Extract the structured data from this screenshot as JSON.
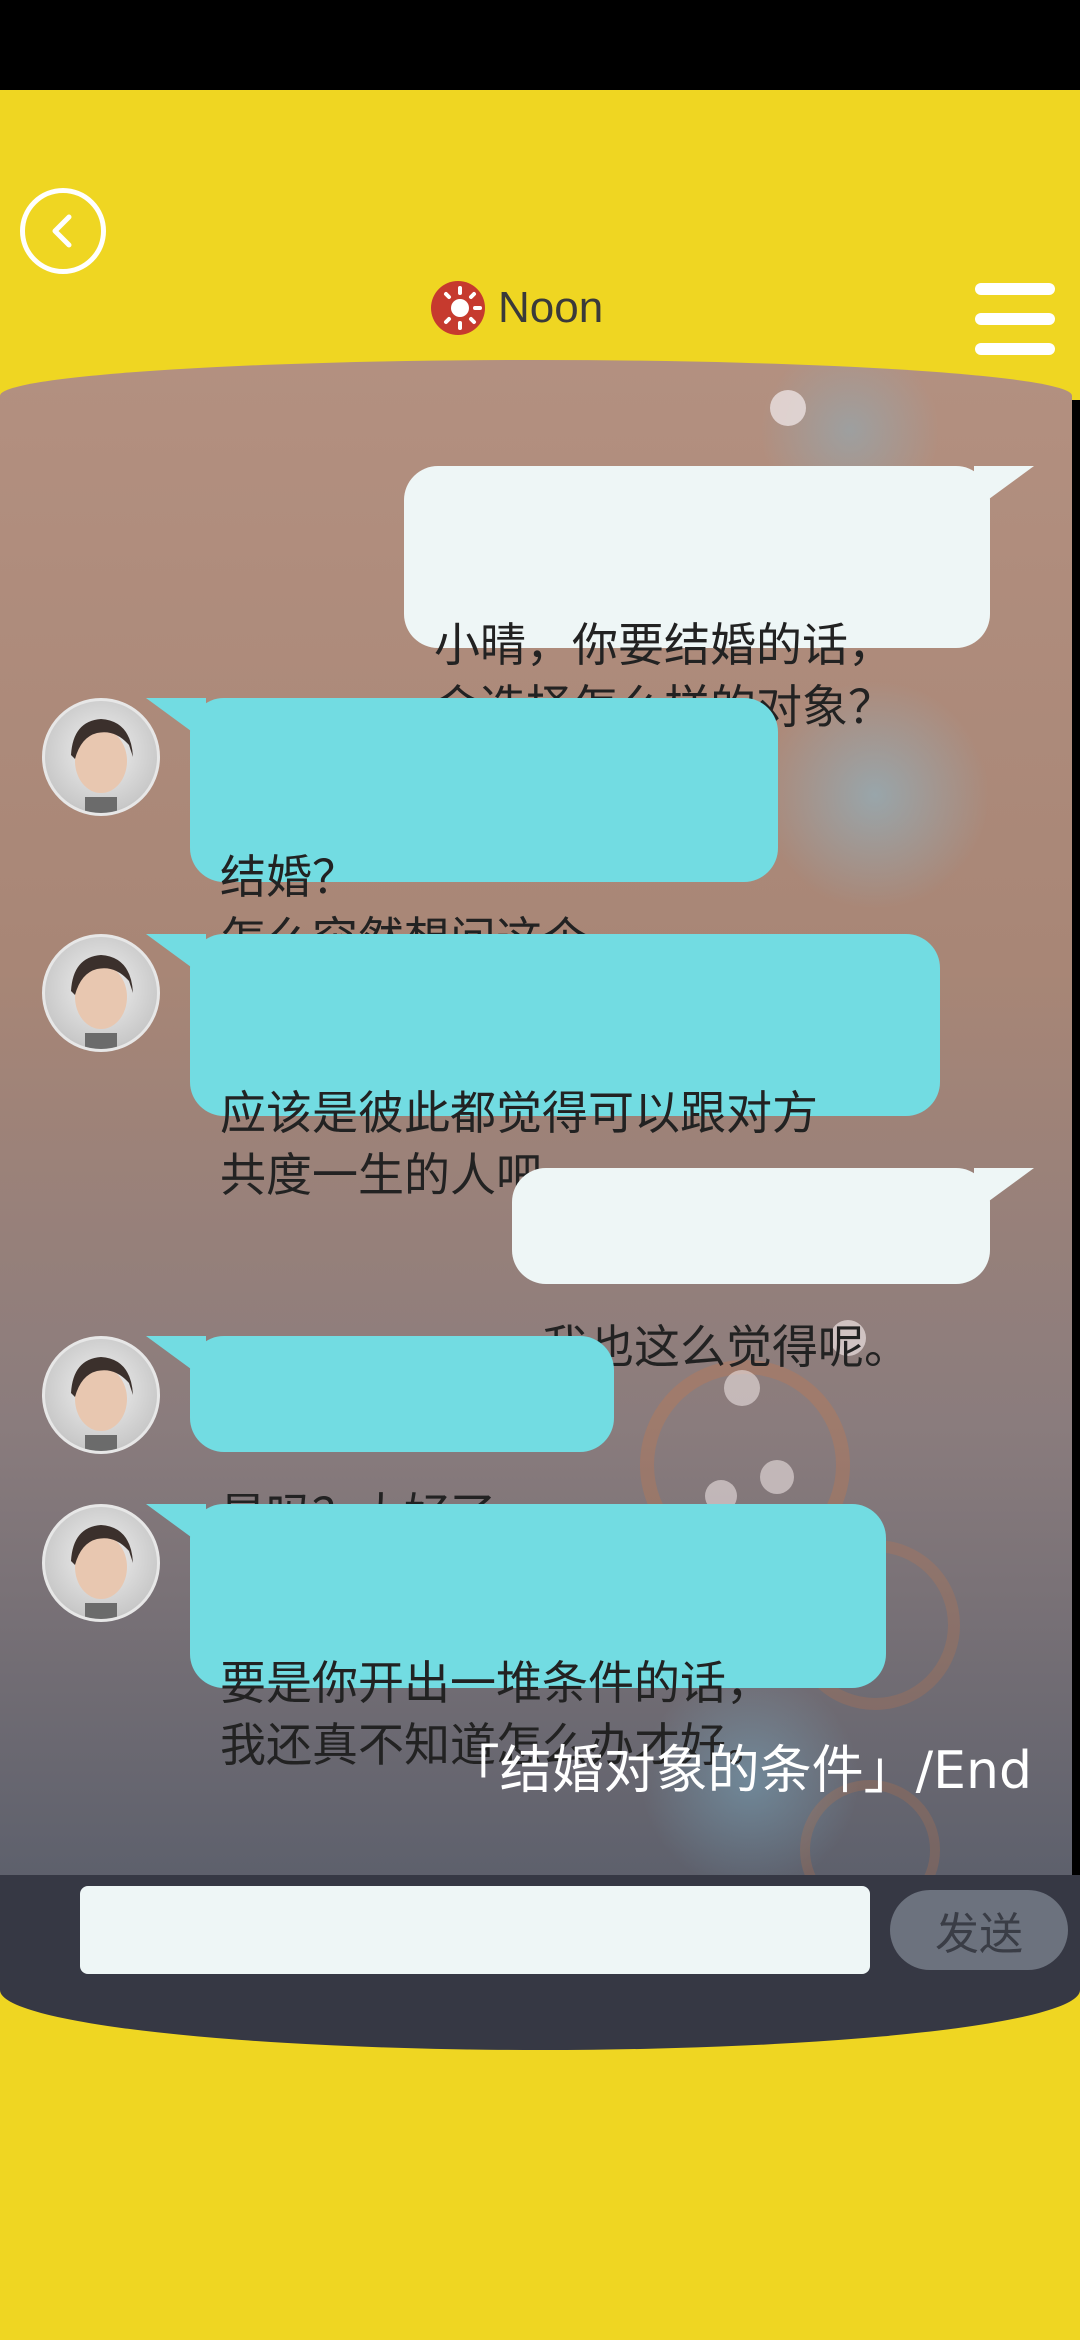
{
  "header": {
    "period_label": "Noon",
    "back_icon": "back-chevron-icon",
    "period_icon": "sun-icon",
    "menu_icon": "hamburger-menu-icon"
  },
  "chat": {
    "messages": [
      {
        "sender": "me",
        "text": "小晴，你要结婚的话，\n会选择怎么样的对象？"
      },
      {
        "sender": "her",
        "text": "结婚？\n怎么突然想问这个……"
      },
      {
        "sender": "her",
        "text": "应该是彼此都觉得可以跟对方\n共度一生的人吧。"
      },
      {
        "sender": "me",
        "text": "我也这么觉得呢。"
      },
      {
        "sender": "her",
        "text": "是吗？太好了。"
      },
      {
        "sender": "her",
        "text": "要是你开出一堆条件的话，\n我还真不知道怎么办才好。"
      }
    ],
    "end_caption": "「结婚对象的条件」/End"
  },
  "input": {
    "value": "",
    "placeholder": "",
    "send_label": "发送"
  },
  "colors": {
    "background_yellow": "#efd622",
    "my_bubble": "#eef6f6",
    "her_bubble": "#72dce2",
    "input_bar": "#363844",
    "send_button": "#6c727e"
  }
}
